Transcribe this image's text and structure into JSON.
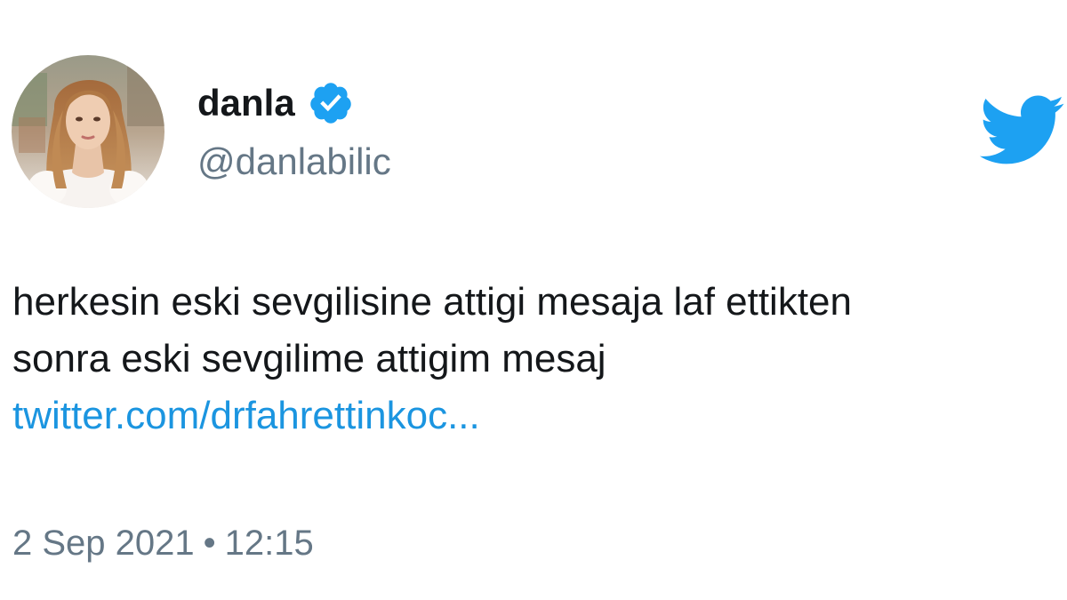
{
  "author": {
    "display_name": "danla",
    "handle": "@danlabilic",
    "verified": true
  },
  "tweet": {
    "text_lines": [
      "herkesin eski sevgilisine attigi mesaja laf ettikten",
      "sonra eski sevgilime attigim mesaj"
    ],
    "link_text": "twitter.com/drfahrettinkoc..."
  },
  "meta": {
    "date": "2 Sep 2021",
    "separator": "•",
    "time": "12:15"
  },
  "colors": {
    "text": "#14171a",
    "secondary": "#657786",
    "link": "#1b95e0",
    "twitter_blue": "#1da1f2",
    "verified_blue": "#1da1f2"
  },
  "icons": {
    "brand": "twitter-bird-icon",
    "verified": "verified-badge-icon"
  }
}
